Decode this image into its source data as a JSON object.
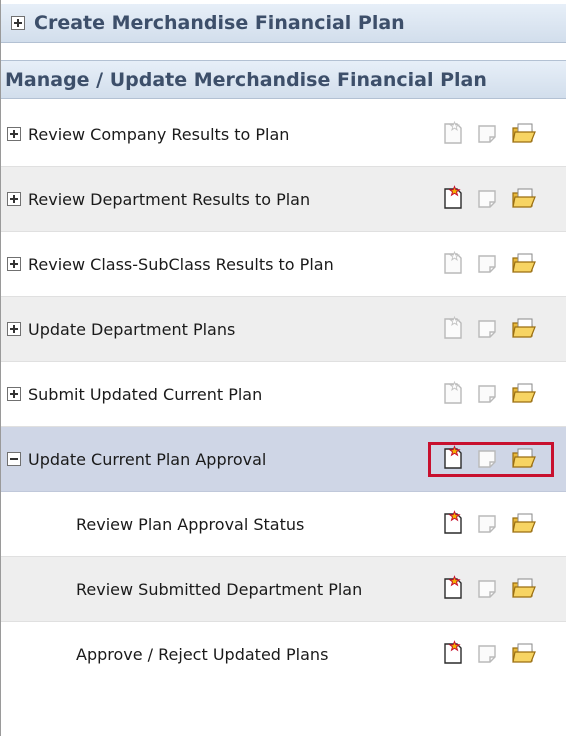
{
  "groups": {
    "create": {
      "label": "Create Merchandise Financial Plan",
      "expanded": false
    },
    "manage": {
      "label": "Manage / Update Merchandise Financial Plan",
      "expanded": true
    }
  },
  "rows": [
    {
      "label": "Review Company Results to Plan",
      "level": 1,
      "expanded": false,
      "new_task_enabled": false
    },
    {
      "label": "Review Department Results to Plan",
      "level": 1,
      "expanded": false,
      "new_task_enabled": true
    },
    {
      "label": "Review Class-SubClass Results to Plan",
      "level": 1,
      "expanded": false,
      "new_task_enabled": false
    },
    {
      "label": "Update Department Plans",
      "level": 1,
      "expanded": false,
      "new_task_enabled": false
    },
    {
      "label": "Submit Updated Current Plan",
      "level": 1,
      "expanded": false,
      "new_task_enabled": false
    },
    {
      "label": "Update Current Plan Approval",
      "level": 1,
      "expanded": true,
      "selected": true,
      "new_task_enabled": true
    },
    {
      "label": "Review Plan Approval Status",
      "level": 2,
      "new_task_enabled": true
    },
    {
      "label": "Review Submitted Department Plan",
      "level": 2,
      "new_task_enabled": true
    },
    {
      "label": "Approve / Reject Updated Plans",
      "level": 2,
      "new_task_enabled": true
    }
  ],
  "icons": [
    "new-task-icon",
    "close-task-icon",
    "open-task-icon"
  ],
  "colors": {
    "header_text": "#3d4f6a",
    "header_bg": "#d9e4f1",
    "selected_row_bg": "#cfd6e6",
    "alt_row_bg": "#eeeeee",
    "highlight_border": "#c8102e"
  }
}
